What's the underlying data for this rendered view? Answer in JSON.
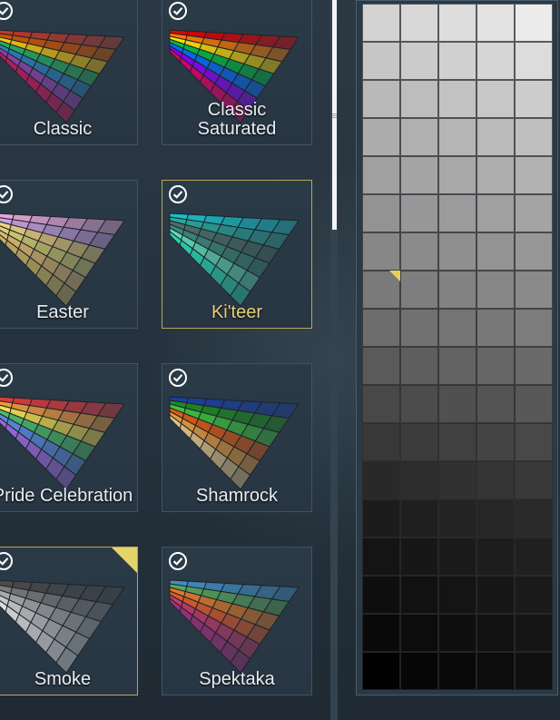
{
  "palettes": [
    {
      "label": "Classic",
      "selected": false,
      "active": false,
      "hues": [
        "#c0392b",
        "#d35400",
        "#f1c40f",
        "#27ae60",
        "#2980b9",
        "#8e44ad",
        "#c2185b"
      ]
    },
    {
      "label": "Classic\nSaturated",
      "selected": false,
      "active": false,
      "hues": [
        "#e00000",
        "#ff7a00",
        "#ffe000",
        "#00c040",
        "#0070ff",
        "#8a00ff",
        "#e0006a"
      ]
    },
    {
      "label": "Easter",
      "selected": false,
      "active": false,
      "hues": [
        "#e8a7d8",
        "#c9a0e0",
        "#f0d080",
        "#d8d070",
        "#e0b870",
        "#c8b060"
      ]
    },
    {
      "label": "Ki'teer",
      "selected": true,
      "active": true,
      "hues": [
        "#18c0c8",
        "#2aa79e",
        "#4b6f6a",
        "#3d8a7d",
        "#62d8b6",
        "#2bd4b0"
      ]
    },
    {
      "label": "Pride Celebration",
      "selected": false,
      "active": false,
      "hues": [
        "#e03a3a",
        "#f19a3e",
        "#f4e04d",
        "#4bbf6b",
        "#5a8be0",
        "#9b6be0"
      ]
    },
    {
      "label": "Shamrock",
      "selected": false,
      "active": false,
      "hues": [
        "#1a3fa0",
        "#1e8a1e",
        "#3ec43e",
        "#e05a10",
        "#e89a3a",
        "#e3c48a"
      ]
    },
    {
      "label": "Smoke",
      "selected": true,
      "active": false,
      "hues": [
        "#4a4a4a",
        "#7a7a7a",
        "#a9a9a9",
        "#c8c8c8",
        "#dcdcdc"
      ]
    },
    {
      "label": "Spektaka",
      "selected": false,
      "active": false,
      "hues": [
        "#3f8fc0",
        "#5aa65a",
        "#e07a2a",
        "#e05a2a",
        "#c03a6a",
        "#a0307a"
      ]
    }
  ],
  "colors": {
    "accent": "#e8cf5a",
    "check": "#ffffff",
    "selected_label": "#e8d073"
  },
  "grid": {
    "columns": 5,
    "rows": 18,
    "selected_cell": {
      "row": 7,
      "col": 0
    },
    "shades": [
      [
        "#d3d3d3",
        "#d8d8d8",
        "#dddddd",
        "#e3e3e3",
        "#ebebeb"
      ],
      [
        "#c6c6c6",
        "#cbcbcb",
        "#d0d0d0",
        "#d6d6d6",
        "#dcdcdc"
      ],
      [
        "#b9b9b9",
        "#bdbdbd",
        "#c2c2c2",
        "#c7c7c7",
        "#cdcdcd"
      ],
      [
        "#acacac",
        "#b0b0b0",
        "#b5b5b5",
        "#bababa",
        "#bfbfbf"
      ],
      [
        "#a0a0a0",
        "#a4a4a4",
        "#a8a8a8",
        "#adadad",
        "#b2b2b2"
      ],
      [
        "#939393",
        "#979797",
        "#9b9b9b",
        "#a0a0a0",
        "#a4a4a4"
      ],
      [
        "#878787",
        "#8b8b8b",
        "#8f8f8f",
        "#939393",
        "#979797"
      ],
      [
        "#7a7a7a",
        "#7e7e7e",
        "#828282",
        "#868686",
        "#8a8a8a"
      ],
      [
        "#6d6d6d",
        "#717171",
        "#747474",
        "#787878",
        "#7c7c7c"
      ],
      [
        "#5a5a5a",
        "#5e5e5e",
        "#626262",
        "#666666",
        "#6a6a6a"
      ],
      [
        "#484848",
        "#4c4c4c",
        "#505050",
        "#545454",
        "#585858"
      ],
      [
        "#383838",
        "#3c3c3c",
        "#404040",
        "#444444",
        "#484848"
      ],
      [
        "#292929",
        "#2d2d2d",
        "#313131",
        "#353535",
        "#393939"
      ],
      [
        "#1c1c1c",
        "#1f1f1f",
        "#232323",
        "#262626",
        "#2a2a2a"
      ],
      [
        "#141414",
        "#171717",
        "#1a1a1a",
        "#1d1d1d",
        "#202020"
      ],
      [
        "#0e0e0e",
        "#111111",
        "#141414",
        "#171717",
        "#1a1a1a"
      ],
      [
        "#090909",
        "#0c0c0c",
        "#0f0f0f",
        "#121212",
        "#151515"
      ],
      [
        "#020202",
        "#060606",
        "#090909",
        "#0c0c0c",
        "#101010"
      ]
    ]
  }
}
